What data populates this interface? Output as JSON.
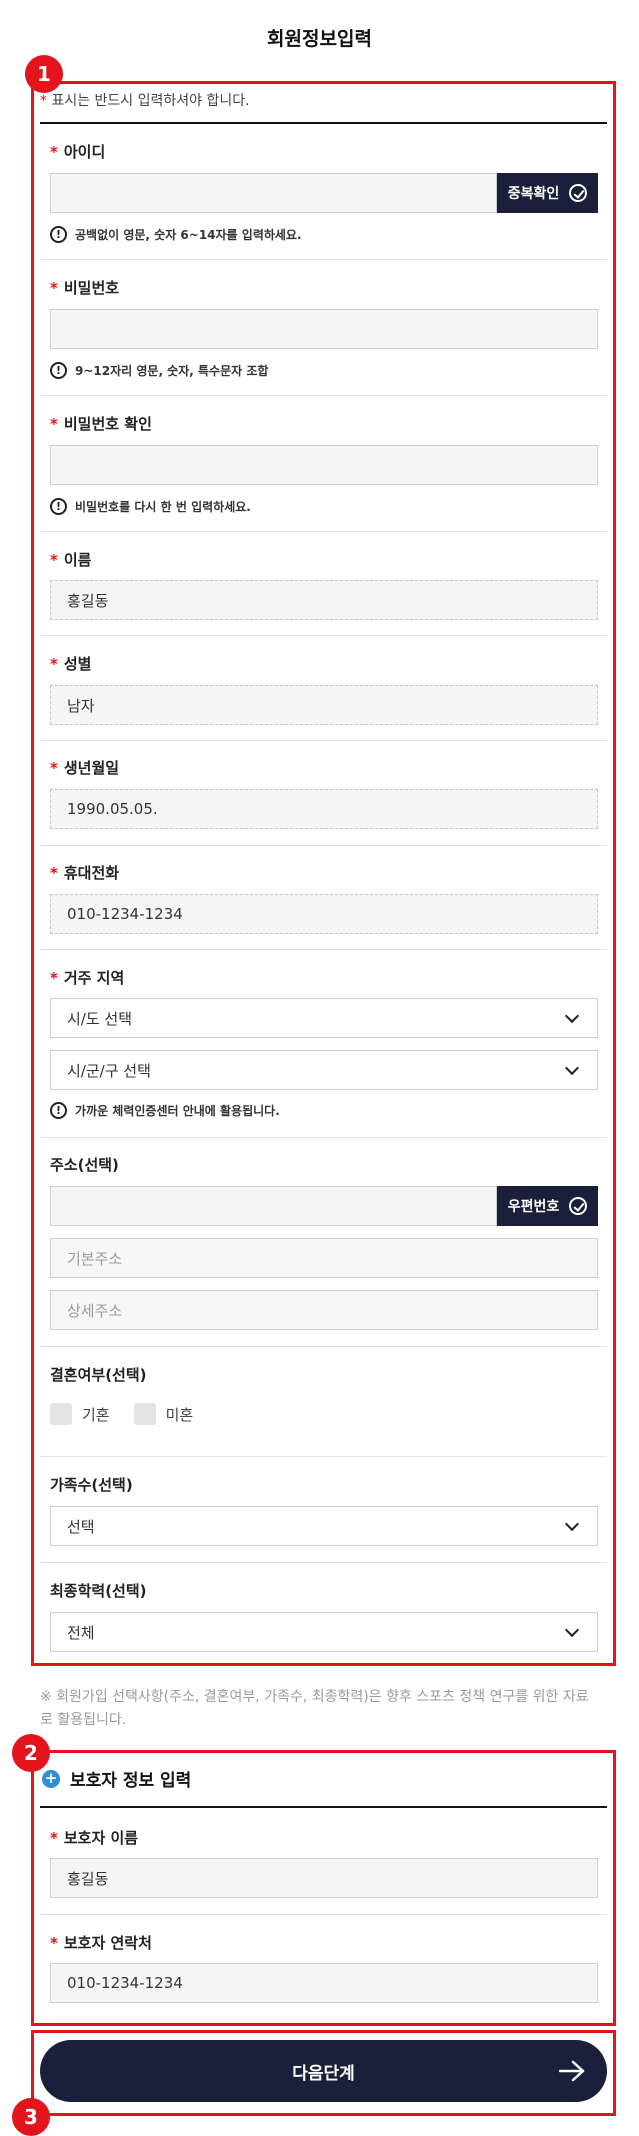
{
  "page_title": "회원정보입력",
  "markers": [
    "1",
    "2",
    "3"
  ],
  "required_note": "표시는 반드시 입력하셔야 합니다.",
  "required_star": "*",
  "fields": {
    "id": {
      "label": "아이디",
      "value": "",
      "button": "중복확인",
      "hint": "공백없이 영문, 숫자 6~14자를 입력하세요."
    },
    "password": {
      "label": "비밀번호",
      "value": "",
      "hint": "9~12자리 영문, 숫자, 특수문자 조합"
    },
    "password_confirm": {
      "label": "비밀번호 확인",
      "value": "",
      "hint": "비밀번호를 다시 한 번 입력하세요."
    },
    "name": {
      "label": "이름",
      "value": "홍길동"
    },
    "gender": {
      "label": "성별",
      "value": "남자"
    },
    "birth": {
      "label": "생년월일",
      "value": "1990.05.05."
    },
    "phone": {
      "label": "휴대전화",
      "value": "010-1234-1234"
    },
    "region": {
      "label": "거주 지역",
      "select1": "시/도 선택",
      "select2": "시/군/구 선택",
      "hint": "가까운 체력인증센터 안내에 활용됩니다."
    },
    "address": {
      "label": "주소(선택)",
      "button": "우편번호",
      "placeholder_basic": "기본주소",
      "placeholder_detail": "상세주소"
    },
    "marriage": {
      "label": "결혼여부(선택)",
      "options": [
        "기혼",
        "미혼"
      ]
    },
    "family": {
      "label": "가족수(선택)",
      "select": "선택"
    },
    "education": {
      "label": "최종학력(선택)",
      "select": "전체"
    }
  },
  "notice": "※ 회원가입 선택사항(주소, 결혼여부, 가족수, 최종학력)은 향후 스포츠 정책 연구를 위한 자료로 활용됩니다.",
  "guardian": {
    "title": "보호자 정보 입력",
    "name_label": "보호자 이름",
    "name_value": "홍길동",
    "contact_label": "보호자 연락처",
    "contact_value": "010-1234-1234"
  },
  "next_button": "다음단계",
  "colors": {
    "accent_red": "#e3141b",
    "navy": "#1b1f3b",
    "info_blue": "#2e8fd8"
  }
}
